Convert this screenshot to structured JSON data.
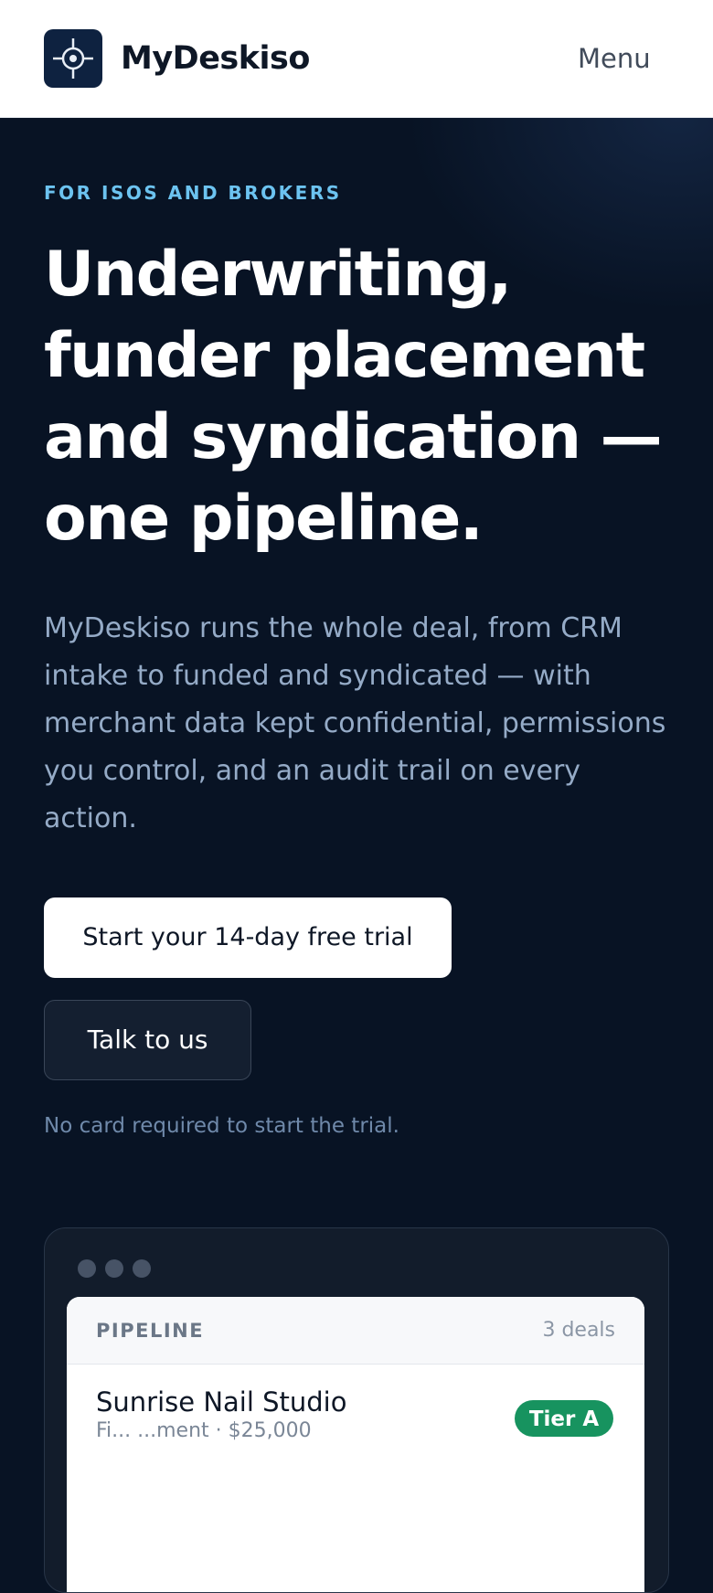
{
  "header": {
    "brand": "MyDeskiso",
    "logo_icon": "crosshair-icon",
    "menu_label": "Menu"
  },
  "hero": {
    "eyebrow": "FOR ISOS AND BROKERS",
    "headline_lines": [
      "Underwriting,",
      "funder placement",
      "and syndication —",
      "one pipeline."
    ],
    "lede_lines": [
      "MyDeskiso runs the whole deal, from CRM",
      "intake to funded and syndicated — with",
      "merchant data kept confidential, permissions",
      "you control, and an audit trail on every",
      "action."
    ],
    "primary_cta": "Start your 14-day free trial",
    "secondary_cta": "Talk to us",
    "note": "No card required to start the trial."
  },
  "preview": {
    "panel_title": "PIPELINE",
    "deal_count": "3 deals",
    "deals": [
      {
        "name": "Sunrise Nail Studio",
        "subtitle": "Fi... ...ment · $25,000",
        "tier": "Tier A"
      }
    ]
  },
  "colors": {
    "background": "#081324",
    "accent": "#6cc3f0",
    "tier_a": "#17935f"
  }
}
